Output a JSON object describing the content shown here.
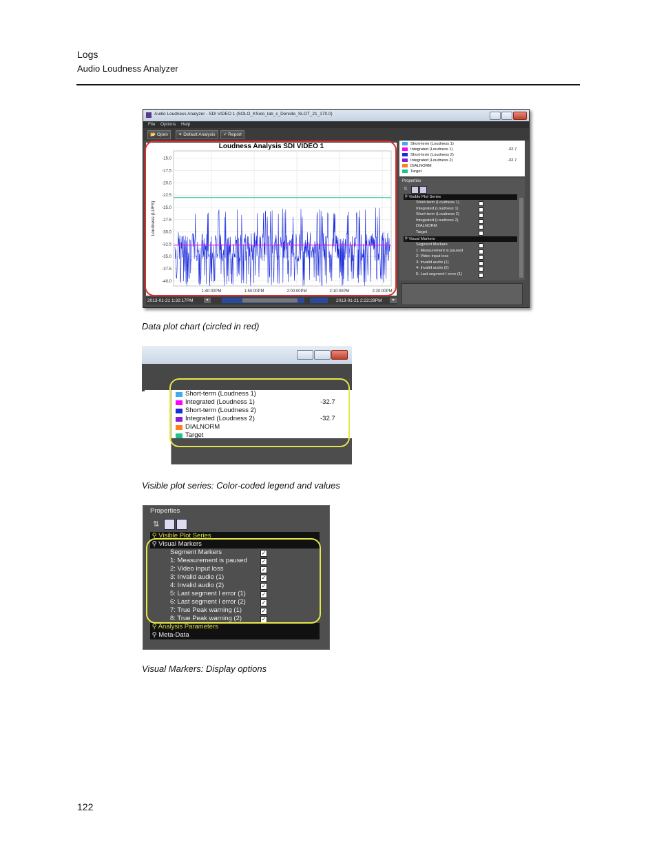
{
  "header": {
    "section": "Logs",
    "subsection": "Audio Loudness Analyzer"
  },
  "app": {
    "title": "Audio Loudness Analyzer - SDI VIDEO 1 (SOLO_KSolo_lab_c_Densite_SLOT_21_170.0)",
    "menu": [
      "File",
      "Options",
      "Help"
    ],
    "toolbar": {
      "open": "Open",
      "default_analysis": "Default Analysis",
      "report": "Report"
    },
    "start_time": "2013-01-21 1:32:17PM",
    "end_time": "2013-01-21 2:22:29PM",
    "properties_title": "Properties",
    "visible_plot_series_title": "Visible Plot Series",
    "visual_markers_title": "Visual Markers",
    "visible_plot_series": [
      "Short-term (Loudness 1)",
      "Integrated (Loudness 1)",
      "Short-term (Loudness 2)",
      "Integrated (Loudness 2)",
      "DIALNORM",
      "Target"
    ],
    "visual_markers": [
      "Segment Markers",
      "1: Measurement is paused",
      "2: Video input loss",
      "3: Invalid audio (1)",
      "4: Invalid audio (2)",
      "5: Last segment I error (1)"
    ]
  },
  "legend": [
    {
      "label": "Short-term (Loudness 1)",
      "color": "#3fa9f5",
      "value": ""
    },
    {
      "label": "Integrated (Loudness 1)",
      "color": "#ff00ff",
      "value": "-32.7"
    },
    {
      "label": "Short-term (Loudness 2)",
      "color": "#1a2bdc",
      "value": ""
    },
    {
      "label": "Integrated (Loudness 2)",
      "color": "#8a1fd0",
      "value": "-32.7"
    },
    {
      "label": "DIALNORM",
      "color": "#ff7f1f",
      "value": ""
    },
    {
      "label": "Target",
      "color": "#21c28c",
      "value": ""
    }
  ],
  "chart_data": {
    "type": "line",
    "title": "Loudness Analysis SDI VIDEO 1",
    "ylabel": "Loudness (LUFS)",
    "xlabel": "",
    "ylim": [
      -41.0,
      -13.5
    ],
    "yticks": [
      "-15.0",
      "-17.5",
      "-20.0",
      "-22.5",
      "-25.0",
      "-27.5",
      "-30.0",
      "-32.5",
      "-35.0",
      "-37.5",
      "-40.0"
    ],
    "xticks": [
      "1:40:00PM",
      "1:50:00PM",
      "2:00:00PM",
      "2:10:00PM",
      "2:20:00PM"
    ],
    "grid": true,
    "series": [
      {
        "name": "Short-term (Loudness 2)",
        "kind": "noisy",
        "approx_mean": -33.0,
        "range": [
          -41.0,
          -27.0
        ]
      },
      {
        "name": "Integrated (Loudness 1)",
        "kind": "flat",
        "value": -32.7
      },
      {
        "name": "Target",
        "kind": "flat",
        "value": -23.0
      }
    ]
  },
  "zoom_legend": [
    {
      "label": "Short-term (Loudness 1)",
      "color": "#3fa9f5",
      "value": ""
    },
    {
      "label": "Integrated (Loudness 1)",
      "color": "#ff00ff",
      "value": "-32.7"
    },
    {
      "label": "Short-term (Loudness 2)",
      "color": "#1a2bdc",
      "value": ""
    },
    {
      "label": "Integrated (Loudness 2)",
      "color": "#8a1fd0",
      "value": "-32.7"
    },
    {
      "label": "DIALNORM",
      "color": "#ff7f1f",
      "value": ""
    },
    {
      "label": "Target",
      "color": "#21c28c",
      "value": ""
    }
  ],
  "zoom_markers": {
    "properties": "Properties",
    "visible_plot_series": "Visible Plot Series",
    "visual_markers": "Visual Markers",
    "items": [
      "Segment Markers",
      "1: Measurement is paused",
      "2: Video input loss",
      "3: Invalid audio (1)",
      "4: Invalid audio (2)",
      "5: Last segment I error (1)",
      "6: Last segment I error (2)",
      "7: True Peak warning (1)",
      "8: True Peak warning (2)"
    ],
    "analysis_parameters": "Analysis Parameters",
    "meta_data": "Meta-Data"
  },
  "captions": {
    "fig1": "Data plot chart (circled in red)",
    "fig2": "Visible plot series: Color-coded legend and values",
    "fig3": "Visual Markers: Display options"
  },
  "page_number": "122"
}
